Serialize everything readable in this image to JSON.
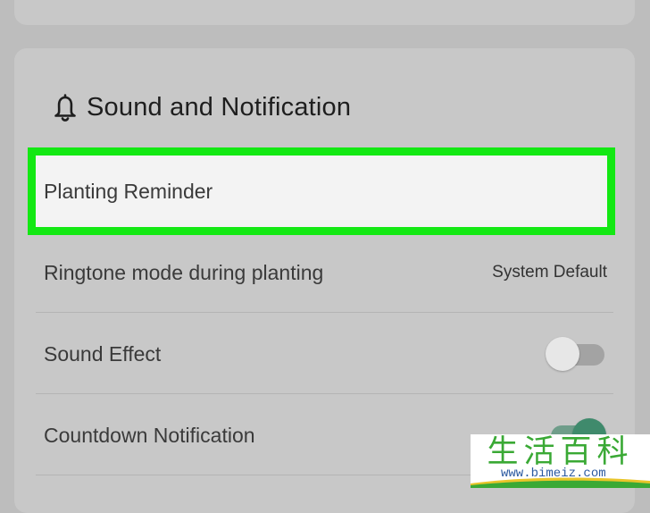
{
  "section": {
    "title": "Sound and Notification",
    "icon": "bell-icon"
  },
  "rows": {
    "planting_reminder": {
      "label": "Planting Reminder",
      "highlight_color": "#13e813"
    },
    "ringtone_mode": {
      "label": "Ringtone mode during planting",
      "value": "System Default"
    },
    "sound_effect": {
      "label": "Sound Effect",
      "toggle_on": false
    },
    "countdown_notification": {
      "label": "Countdown Notification",
      "toggle_on": true
    }
  },
  "watermark": {
    "title": "生活百科",
    "url": "www.bimeiz.com"
  },
  "colors": {
    "background": "#bdbdbd",
    "card": "#c8c8c8",
    "toggle_on": "#3f8a6c",
    "watermark_green": "#3aa935",
    "watermark_blue": "#2c5aa0"
  }
}
